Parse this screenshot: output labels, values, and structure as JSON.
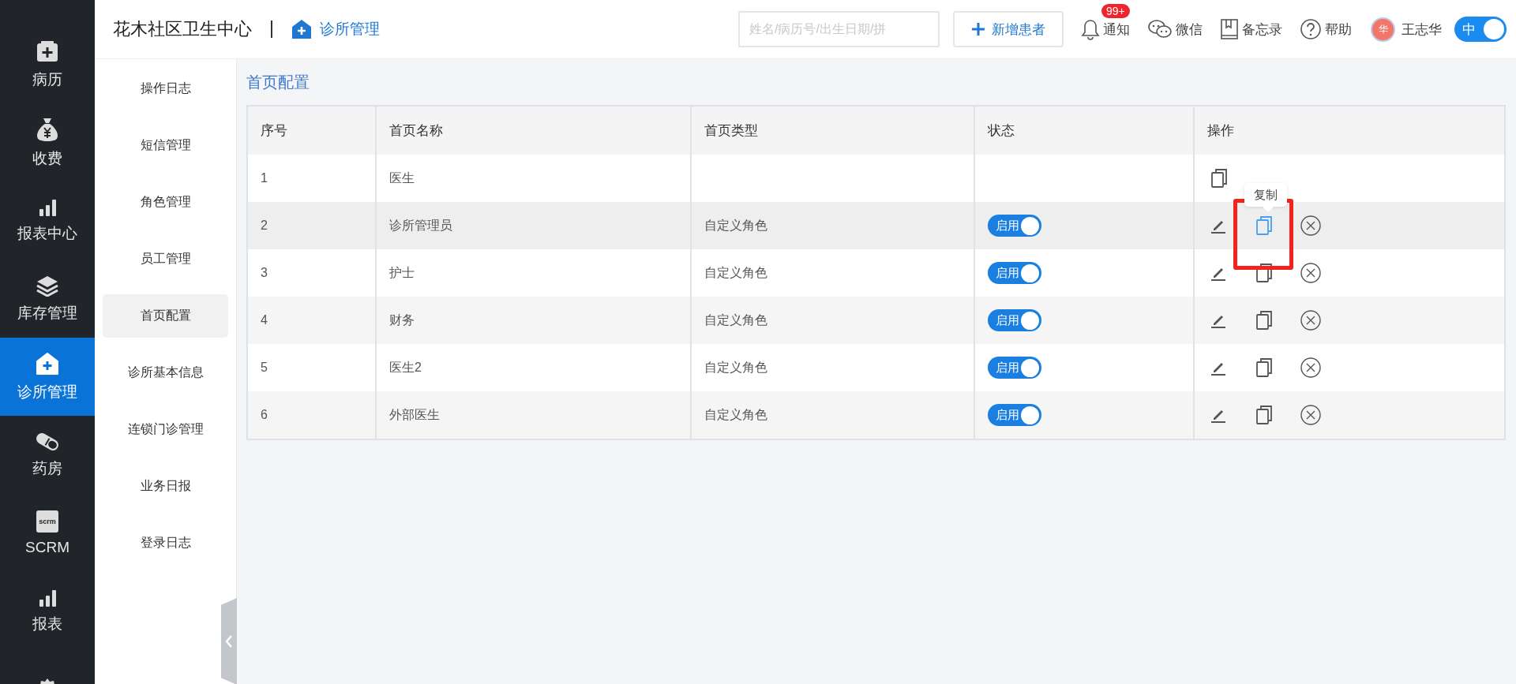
{
  "nav": {
    "items": [
      {
        "kind": "record",
        "label": "病历",
        "selected": false
      },
      {
        "kind": "fee",
        "label": "收费",
        "selected": false
      },
      {
        "kind": "chart",
        "label": "报表中心",
        "selected": false
      },
      {
        "kind": "stock",
        "label": "库存管理",
        "selected": false
      },
      {
        "kind": "clinic",
        "label": "诊所管理",
        "selected": true
      },
      {
        "kind": "pharmacy",
        "label": "药房",
        "selected": false
      },
      {
        "kind": "scrm",
        "label": "SCRM",
        "icon_text": "scrm",
        "selected": false
      },
      {
        "kind": "chart",
        "label": "报表",
        "selected": false
      },
      {
        "kind": "settings",
        "selected": false
      }
    ]
  },
  "header": {
    "title": "花木社区卫生中心",
    "breadcrumb": "诊所管理",
    "search": {
      "placeholder": "姓名/病历号/出生日期/拼"
    },
    "add_button": "新增患者",
    "tools": [
      {
        "kind": "bell",
        "label": "通知",
        "badge": "99+"
      },
      {
        "kind": "chat",
        "label": "微信"
      },
      {
        "kind": "book",
        "label": "备忘录"
      },
      {
        "kind": "help",
        "label": "帮助"
      }
    ],
    "user": {
      "avatar": "华",
      "name": "王志华"
    },
    "language_toggle": {
      "label": "中",
      "on": true
    }
  },
  "subnav": {
    "items": [
      {
        "label": "操作日志",
        "selected": false
      },
      {
        "label": "短信管理",
        "selected": false
      },
      {
        "label": "角色管理",
        "selected": false
      },
      {
        "label": "员工管理",
        "selected": false
      },
      {
        "label": "首页配置",
        "selected": true
      },
      {
        "label": "诊所基本信息",
        "selected": false
      },
      {
        "label": "连锁门诊管理",
        "selected": false
      },
      {
        "label": "业务日报",
        "selected": false
      },
      {
        "label": "登录日志",
        "selected": false
      }
    ]
  },
  "page": {
    "title": "首页配置"
  },
  "table": {
    "columns": [
      "序号",
      "首页名称",
      "首页类型",
      "状态",
      "操作"
    ],
    "rows": [
      {
        "index": "1",
        "name": "医生",
        "hovered": false,
        "actions": [
          {
            "kind": "copy",
            "hovered": false
          }
        ]
      },
      {
        "index": "2",
        "name": "诊所管理员",
        "type": "自定义角色",
        "status": {
          "label": "启用",
          "on": true
        },
        "hovered": true,
        "actions": [
          {
            "kind": "edit",
            "hovered": false
          },
          {
            "kind": "copy",
            "hovered": true,
            "highlighted": true,
            "tooltip": "复制"
          },
          {
            "kind": "delete",
            "hovered": false
          }
        ]
      },
      {
        "index": "3",
        "name": "护士",
        "type": "自定义角色",
        "status": {
          "label": "启用",
          "on": true
        },
        "hovered": false,
        "actions": [
          {
            "kind": "edit",
            "hovered": false
          },
          {
            "kind": "copy",
            "hovered": false
          },
          {
            "kind": "delete",
            "hovered": false
          }
        ]
      },
      {
        "index": "4",
        "name": "财务",
        "type": "自定义角色",
        "status": {
          "label": "启用",
          "on": true
        },
        "hovered": false,
        "actions": [
          {
            "kind": "edit",
            "hovered": false
          },
          {
            "kind": "copy",
            "hovered": false
          },
          {
            "kind": "delete",
            "hovered": false
          }
        ]
      },
      {
        "index": "5",
        "name": "医生2",
        "type": "自定义角色",
        "status": {
          "label": "启用",
          "on": true
        },
        "hovered": false,
        "actions": [
          {
            "kind": "edit",
            "hovered": false
          },
          {
            "kind": "copy",
            "hovered": false
          },
          {
            "kind": "delete",
            "hovered": false
          }
        ]
      },
      {
        "index": "6",
        "name": "外部医生",
        "type": "自定义角色",
        "status": {
          "label": "启用",
          "on": true
        },
        "hovered": false,
        "actions": [
          {
            "kind": "edit",
            "hovered": false
          },
          {
            "kind": "copy",
            "hovered": false
          },
          {
            "kind": "delete",
            "hovered": false
          }
        ]
      }
    ]
  }
}
